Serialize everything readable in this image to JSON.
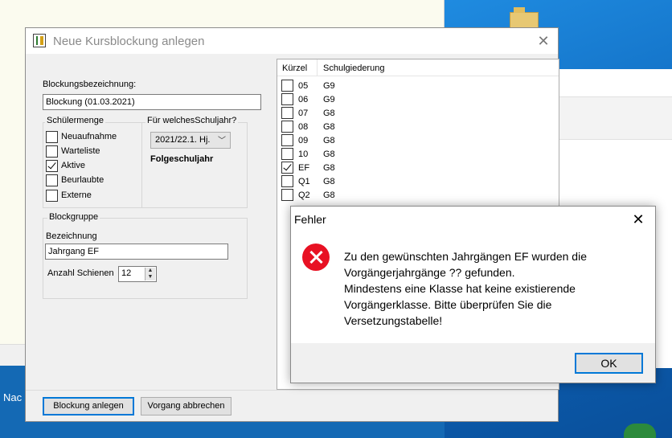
{
  "taskbar_text": "Nac",
  "dialog": {
    "title": "Neue Kursblockung anlegen",
    "bezeichnung_label": "Blockungsbezeichnung:",
    "bezeichnung_value": "Blockung (01.03.2021)",
    "schuelermenge": {
      "title": "Schülermenge",
      "items": [
        {
          "label": "Neuaufnahme",
          "checked": false
        },
        {
          "label": "Warteliste",
          "checked": false
        },
        {
          "label": "Aktive",
          "checked": true
        },
        {
          "label": "Beurlaubte",
          "checked": false
        },
        {
          "label": "Externe",
          "checked": false
        }
      ]
    },
    "schuljahr": {
      "title": "Für welchesSchuljahr?",
      "selected": "2021/22.1. Hj.",
      "note": "Folgeschuljahr"
    },
    "blockgruppe": {
      "title": "Blockgruppe",
      "bezeichnung_label": "Bezeichnung",
      "bezeichnung_value": "Jahrgang EF",
      "schienen_label": "Anzahl Schienen",
      "schienen_value": "12"
    },
    "list": {
      "headers": [
        "Kürzel",
        "Schulgiederung"
      ],
      "rows": [
        {
          "code": "05",
          "sg": "G9",
          "checked": false
        },
        {
          "code": "06",
          "sg": "G9",
          "checked": false
        },
        {
          "code": "07",
          "sg": "G8",
          "checked": false
        },
        {
          "code": "08",
          "sg": "G8",
          "checked": false
        },
        {
          "code": "09",
          "sg": "G8",
          "checked": false
        },
        {
          "code": "10",
          "sg": "G8",
          "checked": false
        },
        {
          "code": "EF",
          "sg": "G8",
          "checked": true
        },
        {
          "code": "Q1",
          "sg": "G8",
          "checked": false
        },
        {
          "code": "Q2",
          "sg": "G8",
          "checked": false
        }
      ]
    },
    "buttons": {
      "create": "Blockung anlegen",
      "cancel": "Vorgang abbrechen"
    }
  },
  "error": {
    "title": "Fehler",
    "lines": [
      "Zu den gewünschten Jahrgängen EF wurden die",
      "Vorgängerjahrgänge ?? gefunden.",
      "Mindestens eine Klasse hat keine existierende",
      "Vorgängerklasse. Bitte überprüfen Sie die",
      "Versetzungstabelle!"
    ],
    "ok": "OK"
  }
}
